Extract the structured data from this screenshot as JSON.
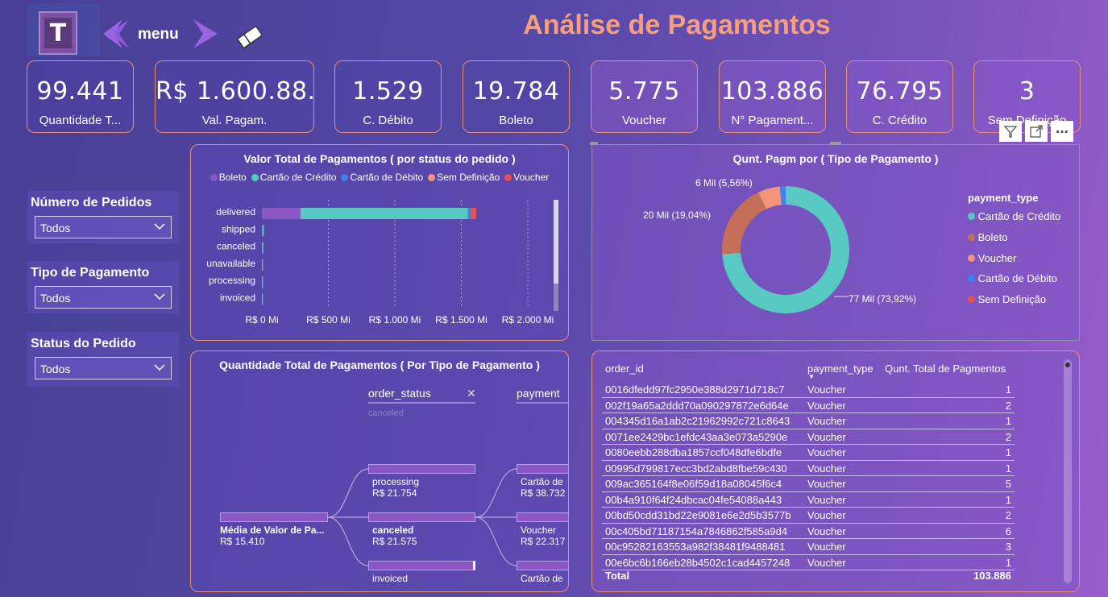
{
  "header": {
    "menu_label": "menu",
    "title": "Análise de Pagamentos",
    "logo_letter": "T"
  },
  "kpis": [
    {
      "value": "99.441",
      "label": "Quantidade T..."
    },
    {
      "value": "R$ 1.600.88...",
      "label": "Val. Pagam."
    },
    {
      "value": "1.529",
      "label": "C. Débito"
    },
    {
      "value": "19.784",
      "label": "Boleto"
    },
    {
      "value": "5.775",
      "label": "Voucher"
    },
    {
      "value": "103.886",
      "label": "N° Pagament..."
    },
    {
      "value": "76.795",
      "label": "C. Crédito"
    },
    {
      "value": "3",
      "label": "Sem Definição"
    }
  ],
  "slicers": [
    {
      "title": "Número de Pedidos",
      "value": "Todos"
    },
    {
      "title": "Tipo de Pagamento",
      "value": "Todos"
    },
    {
      "title": "Status do Pedido",
      "value": "Todos"
    }
  ],
  "colors": {
    "boleto": "#8a57c4",
    "credito": "#58c9c3",
    "debito": "#3d82f0",
    "sem": "#f4957b",
    "voucher": "#e95050"
  },
  "bar_chart": {
    "title": "Valor Total de Pagamentos ( por status do pedido )",
    "legend": [
      "Boleto",
      "Cartão de Crédito",
      "Cartão de Débito",
      "Sem Definição",
      "Voucher"
    ],
    "ticks": [
      "R$ 0 Mi",
      "R$ 500 Mi",
      "R$ 1.000 Mi",
      "R$ 1.500 Mi",
      "R$ 2.000 Mi"
    ],
    "chart_data": {
      "type": "bar",
      "categories": [
        "delivered",
        "shipped",
        "canceled",
        "unavailable",
        "processing",
        "invoiced"
      ],
      "series": [
        {
          "name": "Boleto",
          "values": [
            290,
            3,
            2,
            1,
            1,
            1
          ]
        },
        {
          "name": "Cartão de Crédito",
          "values": [
            1260,
            12,
            9,
            7,
            5,
            5
          ]
        },
        {
          "name": "Cartão de Débito",
          "values": [
            22,
            0,
            0,
            0,
            0,
            0
          ]
        },
        {
          "name": "Sem Definição",
          "values": [
            0,
            0,
            0,
            0,
            0,
            0
          ]
        },
        {
          "name": "Voucher",
          "values": [
            40,
            0,
            0,
            0,
            0,
            0
          ]
        }
      ],
      "xlim": [
        0,
        2000
      ]
    }
  },
  "donut": {
    "title": "Qunt. Pagm por ( Tipo de Pagamento )",
    "legend_title": "payment_type",
    "legend": [
      "Cartão de Crédito",
      "Boleto",
      "Voucher",
      "Cartão de Débito",
      "Sem Definição"
    ],
    "labels": {
      "credito": "77 Mil (73,92%)",
      "boleto": "20 Mil (19,04%)",
      "voucher": "6 Mil (5,56%)"
    },
    "chart_data": {
      "type": "pie",
      "categories": [
        "Cartão de Crédito",
        "Boleto",
        "Voucher",
        "Cartão de Débito",
        "Sem Definição"
      ],
      "values": [
        73.92,
        19.04,
        5.56,
        1.47,
        0.01
      ]
    }
  },
  "tree": {
    "title": "Quantidade Total de Pagamentos ( Por Tipo de Pagamento )",
    "col1": "order_status",
    "col1_sub": "canceled",
    "col2": "payment",
    "root": {
      "label": "Média de Valor de Pa...",
      "value": "R$ 15.410"
    },
    "level1": [
      {
        "label": "processing",
        "value": "R$ 21.754"
      },
      {
        "label": "canceled",
        "value": "R$ 21.575"
      },
      {
        "label": "invoiced",
        "value": ""
      }
    ],
    "level2": [
      {
        "label": "Cartão de",
        "value": "R$ 38.732"
      },
      {
        "label": "Voucher",
        "value": "R$ 22.317"
      },
      {
        "label": "Cartão de",
        "value": ""
      }
    ]
  },
  "table": {
    "headers": [
      "order_id",
      "payment_type",
      "Qunt. Total de Pagmentos"
    ],
    "rows": [
      [
        "0016dfedd97fc2950e388d2971d718c7",
        "Voucher",
        "1"
      ],
      [
        "002f19a65a2ddd70a090297872e6d64e",
        "Voucher",
        "2"
      ],
      [
        "004345d16a1ab2c21962992c721c8643",
        "Voucher",
        "1"
      ],
      [
        "0071ee2429bc1efdc43aa3e073a5290e",
        "Voucher",
        "2"
      ],
      [
        "0080eebb288dba1857ccf048dfe6bdfe",
        "Voucher",
        "1"
      ],
      [
        "00995d799817ecc3bd2abd8fbe59c430",
        "Voucher",
        "1"
      ],
      [
        "009ac365164f8e06f59d18a08045f6c4",
        "Voucher",
        "5"
      ],
      [
        "00b4a910f64f24dbcac04fe54088a443",
        "Voucher",
        "1"
      ],
      [
        "00bd50cdd31bd22e9081e6e2d5b3577b",
        "Voucher",
        "2"
      ],
      [
        "00c405bd71187154a7846862f585a9d4",
        "Voucher",
        "6"
      ],
      [
        "00c95282163553a982f38481f9488481",
        "Voucher",
        "3"
      ],
      [
        "00e6bc6b166eb28b4502c1cad4457248",
        "Voucher",
        "1"
      ]
    ],
    "total_label": "Total",
    "total_value": "103.886"
  }
}
